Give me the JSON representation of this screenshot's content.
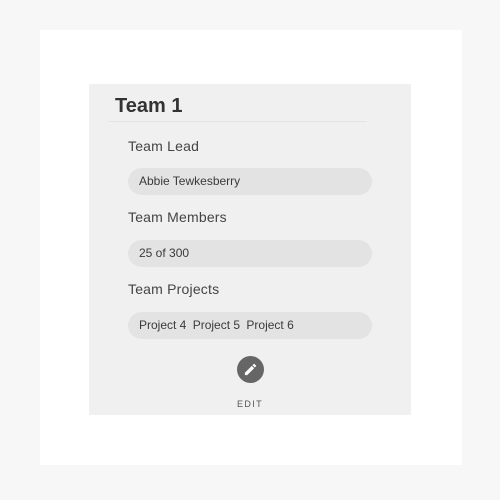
{
  "card": {
    "title": "Team 1",
    "fields": {
      "team_lead": {
        "label": "Team Lead",
        "value": "Abbie Tewkesberry"
      },
      "team_members": {
        "label": "Team Members",
        "value": "25 of 300"
      },
      "team_projects": {
        "label": "Team Projects",
        "values": [
          "Project 4",
          "Project 5",
          "Project 6"
        ]
      }
    },
    "edit": {
      "icon": "pencil-icon",
      "label": "EDIT"
    }
  },
  "colors": {
    "page_background": "#f7f7f7",
    "outer_panel": "#ffffff",
    "card_background": "#f0f0f0",
    "field_background": "#e3e3e3",
    "edit_button": "#666666",
    "text": "#333333"
  }
}
